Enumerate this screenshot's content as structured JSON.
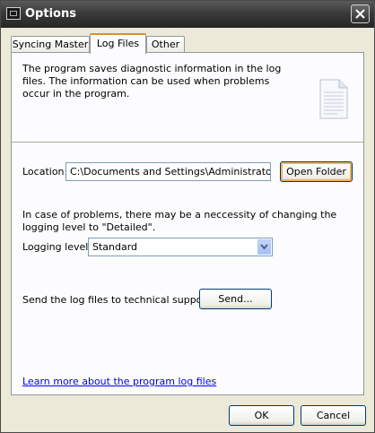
{
  "window": {
    "title": "Options"
  },
  "tabs": [
    {
      "label": "Syncing Master"
    },
    {
      "label": "Log Files",
      "active": true
    },
    {
      "label": "Other"
    }
  ],
  "log_files": {
    "description": "The program saves diagnostic information in the log files. The information can be used when problems occur in the program.",
    "location_label": "Location:",
    "location_value": "C:\\Documents and Settings\\Administrator\\Application Data",
    "open_folder_label": "Open Folder",
    "logging_hint": "In case of problems, there may be a neccessity of changing the logging level to \"Detailed\".",
    "logging_level_label": "Logging level:",
    "logging_level_value": "Standard",
    "send_label": "Send the log files to technical support:",
    "send_button": "Send...",
    "learn_more_link": "Learn more about the program log files"
  },
  "footer": {
    "ok_label": "OK",
    "cancel_label": "Cancel"
  },
  "colors": {
    "active_tab_accent": "#e68b2c",
    "link": "#0000ff",
    "panel_bg": "#fcfcfe",
    "dialog_bg": "#ece9d8"
  },
  "icons": {
    "app": "console-window-icon",
    "document": "text-document-icon",
    "close": "close-icon",
    "dropdown": "chevron-down-icon"
  }
}
